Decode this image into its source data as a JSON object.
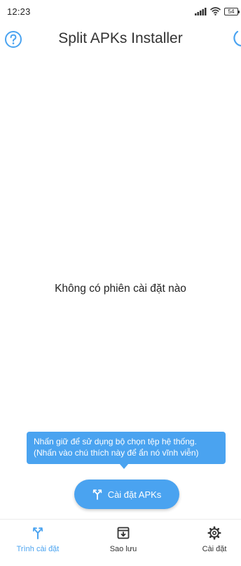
{
  "status_bar": {
    "time": "12:23",
    "battery": "54"
  },
  "app_bar": {
    "title": "Split APKs Installer",
    "help_icon": "help-circle-icon",
    "theme_icon": "moon-icon"
  },
  "main": {
    "empty_message": "Không có phiên cài đặt nào"
  },
  "tooltip": {
    "line1": "Nhấn giữ để sử dụng bộ chọn tệp hệ thống.",
    "line2": "(Nhấn vào chú thích này để ẩn nó vĩnh viễn)"
  },
  "fab": {
    "label": "Cài đặt APKs",
    "icon": "split-arrow-icon"
  },
  "bottom_nav": {
    "items": [
      {
        "label": "Trình cài đặt",
        "icon": "split-arrow-icon",
        "active": true
      },
      {
        "label": "Sao lưu",
        "icon": "archive-icon",
        "active": false
      },
      {
        "label": "Cài đặt",
        "icon": "gear-icon",
        "active": false
      }
    ]
  },
  "colors": {
    "accent": "#4aa3f0",
    "text": "#212121",
    "background": "#ffffff"
  }
}
